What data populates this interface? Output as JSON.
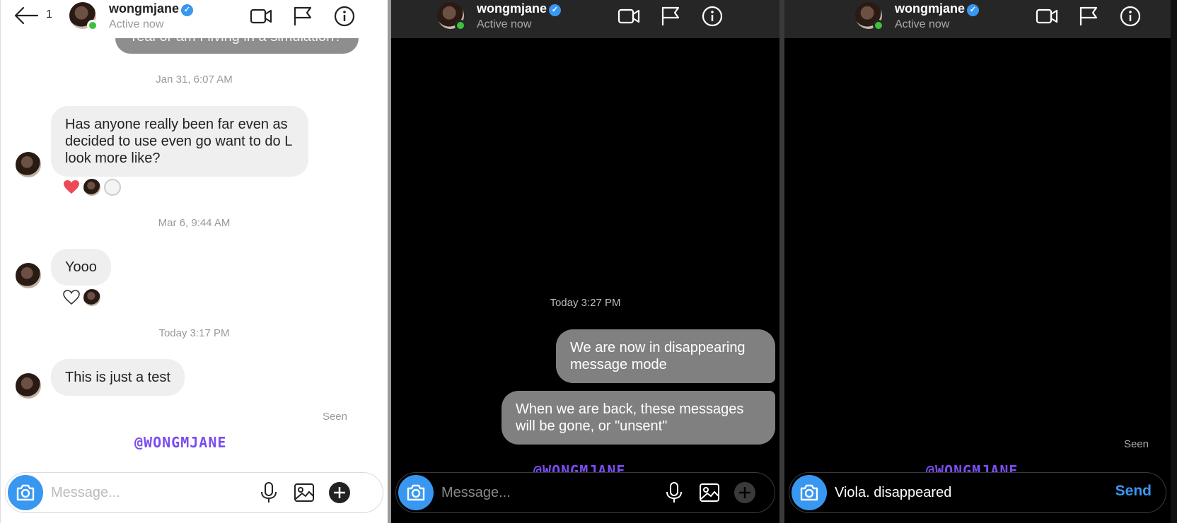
{
  "panel1": {
    "header": {
      "back_count": "1",
      "username": "wongmjane",
      "status": "Active now"
    },
    "cutoff_message": "real or am I living in a simulation?",
    "thread": [
      {
        "timestamp": "Jan 31, 6:07 AM",
        "text": "Has anyone really been far even as decided to use even go want to do L look more like?"
      },
      {
        "timestamp": "Mar 6, 9:44 AM",
        "text": "Yooo"
      },
      {
        "timestamp": "Today 3:17 PM",
        "text": "This is just a test"
      }
    ],
    "seen": "Seen",
    "watermark": "@WONGMJANE",
    "composer": {
      "placeholder": "Message..."
    }
  },
  "panel2": {
    "header": {
      "username": "wongmjane",
      "status": "Active now"
    },
    "timestamp": "Today 3:27 PM",
    "messages": [
      {
        "text": "We are now in disappearing message mode"
      },
      {
        "text": "When we are back, these messages will be gone, or \"unsent\""
      }
    ],
    "watermark": "@WONGMJANE",
    "composer": {
      "placeholder": "Message..."
    }
  },
  "panel3": {
    "header": {
      "username": "wongmjane",
      "status": "Active now"
    },
    "seen": "Seen",
    "watermark": "@WONGMJANE",
    "composer": {
      "value": "Viola. disappeared",
      "send_label": "Send"
    }
  },
  "colors": {
    "accent": "#3897f0",
    "online": "#3cc13b",
    "watermark": "#7a4cf0",
    "heart": "#ed4956"
  },
  "icons": [
    "back-arrow-icon",
    "verified-badge-icon",
    "video-call-icon",
    "flag-icon",
    "info-icon",
    "camera-icon",
    "microphone-icon",
    "gallery-icon",
    "plus-icon",
    "heart-icon"
  ]
}
